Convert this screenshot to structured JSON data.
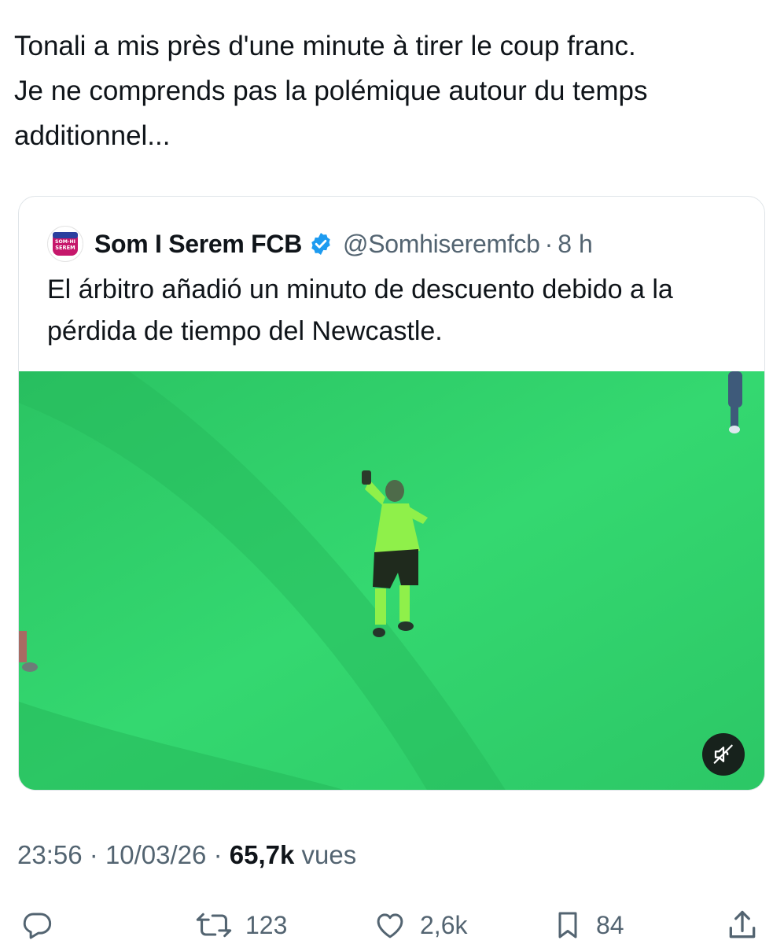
{
  "tweet": {
    "text": "Tonali a mis près d'une minute à tirer le coup franc.\nJe ne comprends pas la polémique autour du temps additionnel..."
  },
  "quote": {
    "avatar_text_top": "SOM-HI",
    "avatar_text_bottom": "SEREM",
    "author_name": "Som I Serem FCB",
    "verified": true,
    "handle": "@Somhiseremfcb",
    "separator": "·",
    "time": "8 h",
    "text": "El árbitro añadió un minuto de descuento debido a la pérdida de tiempo del Newcastle.",
    "media": {
      "kind": "video",
      "muted": true,
      "mute_icon": "speaker-muted-icon"
    }
  },
  "meta": {
    "time": "23:56",
    "sep1": "·",
    "date": "10/03/26",
    "sep2": "·",
    "views_count": "65,7k",
    "views_label": "vues"
  },
  "actions": {
    "reply": {
      "icon": "reply-icon",
      "count": ""
    },
    "retweet": {
      "icon": "retweet-icon",
      "count": "123"
    },
    "like": {
      "icon": "heart-icon",
      "count": "2,6k"
    },
    "bookmark": {
      "icon": "bookmark-icon",
      "count": "84"
    },
    "share": {
      "icon": "share-icon",
      "count": ""
    }
  },
  "colors": {
    "text_primary": "#0f1419",
    "text_secondary": "#536471",
    "verified_blue": "#1d9bf0",
    "pitch_green": "#2fd06a",
    "card_border": "#dfe4e8"
  }
}
